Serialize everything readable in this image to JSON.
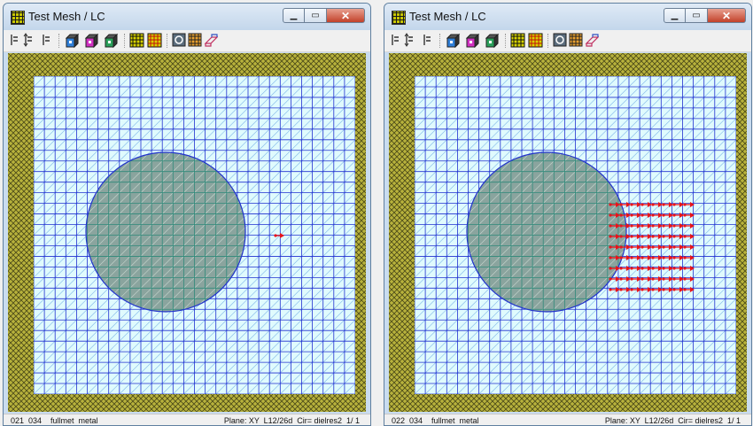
{
  "left_window": {
    "title": "Test Mesh / LC",
    "status_left": "021  034    fullmet  metal",
    "status_right": "Plane: XY  L12/26d  Cir= dielres2  1/ 1",
    "arrows": "single"
  },
  "right_window": {
    "title": "Test Mesh / LC",
    "status_left": "022  034    fullmet  metal",
    "status_right": "Plane: XY  L12/26d  Cir= dielres2  1/ 1",
    "arrows": "grid"
  },
  "window_buttons": {
    "minimize": "▁",
    "maximize": "▭",
    "close": "✕"
  },
  "toolbar_icons": [
    "align-left-icon",
    "align-center-icon",
    "align-right-icon",
    "mesh-cube-blue-icon",
    "mesh-cube-magenta-icon",
    "mesh-cube-green-icon",
    "grid-black-icon",
    "grid-red-icon",
    "view-3d-icon",
    "grid-view-icon",
    "perspective-icon"
  ],
  "colors": {
    "border_hatch": "#b8b23c",
    "mesh_line": "#1f2fd0",
    "mesh_fill": "#e0fbfd",
    "circle_fill": "#8aa49e",
    "arrow": "#e8141b"
  }
}
